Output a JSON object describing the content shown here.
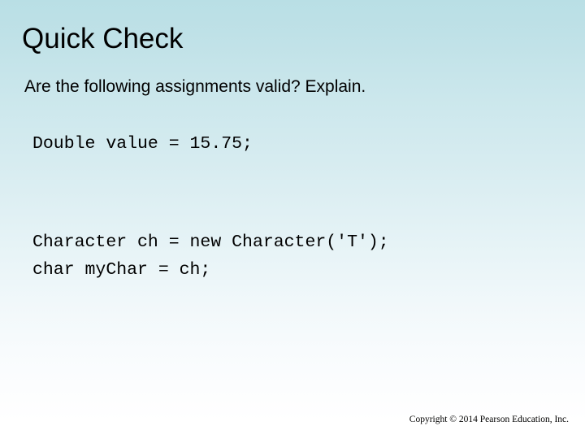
{
  "slide": {
    "title": "Quick Check",
    "subtitle": "Are the following assignments valid? Explain.",
    "code_blocks": [
      {
        "lines": [
          "Double value = 15.75;"
        ]
      },
      {
        "lines": [
          "Character ch = new Character('T');",
          "char myChar = ch;"
        ]
      }
    ],
    "copyright": "Copyright © 2014 Pearson Education, Inc.",
    "colors": {
      "background_top": "#b9dfe5",
      "background_mid": "#dbeef2",
      "background_bottom": "#ffffff",
      "text": "#000000"
    }
  }
}
